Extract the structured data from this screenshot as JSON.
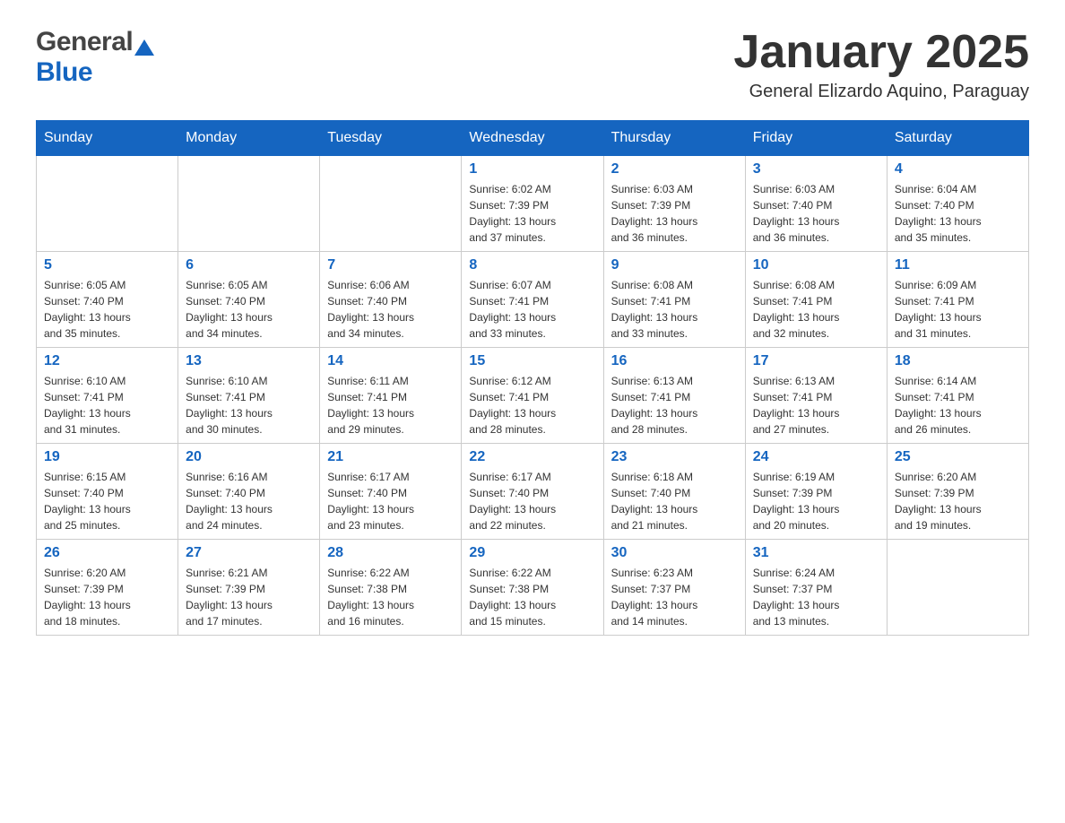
{
  "header": {
    "logo_general": "General",
    "logo_blue": "Blue",
    "main_title": "January 2025",
    "subtitle": "General Elizardo Aquino, Paraguay"
  },
  "calendar": {
    "days_of_week": [
      "Sunday",
      "Monday",
      "Tuesday",
      "Wednesday",
      "Thursday",
      "Friday",
      "Saturday"
    ],
    "weeks": [
      [
        {
          "day": "",
          "info": ""
        },
        {
          "day": "",
          "info": ""
        },
        {
          "day": "",
          "info": ""
        },
        {
          "day": "1",
          "info": "Sunrise: 6:02 AM\nSunset: 7:39 PM\nDaylight: 13 hours\nand 37 minutes."
        },
        {
          "day": "2",
          "info": "Sunrise: 6:03 AM\nSunset: 7:39 PM\nDaylight: 13 hours\nand 36 minutes."
        },
        {
          "day": "3",
          "info": "Sunrise: 6:03 AM\nSunset: 7:40 PM\nDaylight: 13 hours\nand 36 minutes."
        },
        {
          "day": "4",
          "info": "Sunrise: 6:04 AM\nSunset: 7:40 PM\nDaylight: 13 hours\nand 35 minutes."
        }
      ],
      [
        {
          "day": "5",
          "info": "Sunrise: 6:05 AM\nSunset: 7:40 PM\nDaylight: 13 hours\nand 35 minutes."
        },
        {
          "day": "6",
          "info": "Sunrise: 6:05 AM\nSunset: 7:40 PM\nDaylight: 13 hours\nand 34 minutes."
        },
        {
          "day": "7",
          "info": "Sunrise: 6:06 AM\nSunset: 7:40 PM\nDaylight: 13 hours\nand 34 minutes."
        },
        {
          "day": "8",
          "info": "Sunrise: 6:07 AM\nSunset: 7:41 PM\nDaylight: 13 hours\nand 33 minutes."
        },
        {
          "day": "9",
          "info": "Sunrise: 6:08 AM\nSunset: 7:41 PM\nDaylight: 13 hours\nand 33 minutes."
        },
        {
          "day": "10",
          "info": "Sunrise: 6:08 AM\nSunset: 7:41 PM\nDaylight: 13 hours\nand 32 minutes."
        },
        {
          "day": "11",
          "info": "Sunrise: 6:09 AM\nSunset: 7:41 PM\nDaylight: 13 hours\nand 31 minutes."
        }
      ],
      [
        {
          "day": "12",
          "info": "Sunrise: 6:10 AM\nSunset: 7:41 PM\nDaylight: 13 hours\nand 31 minutes."
        },
        {
          "day": "13",
          "info": "Sunrise: 6:10 AM\nSunset: 7:41 PM\nDaylight: 13 hours\nand 30 minutes."
        },
        {
          "day": "14",
          "info": "Sunrise: 6:11 AM\nSunset: 7:41 PM\nDaylight: 13 hours\nand 29 minutes."
        },
        {
          "day": "15",
          "info": "Sunrise: 6:12 AM\nSunset: 7:41 PM\nDaylight: 13 hours\nand 28 minutes."
        },
        {
          "day": "16",
          "info": "Sunrise: 6:13 AM\nSunset: 7:41 PM\nDaylight: 13 hours\nand 28 minutes."
        },
        {
          "day": "17",
          "info": "Sunrise: 6:13 AM\nSunset: 7:41 PM\nDaylight: 13 hours\nand 27 minutes."
        },
        {
          "day": "18",
          "info": "Sunrise: 6:14 AM\nSunset: 7:41 PM\nDaylight: 13 hours\nand 26 minutes."
        }
      ],
      [
        {
          "day": "19",
          "info": "Sunrise: 6:15 AM\nSunset: 7:40 PM\nDaylight: 13 hours\nand 25 minutes."
        },
        {
          "day": "20",
          "info": "Sunrise: 6:16 AM\nSunset: 7:40 PM\nDaylight: 13 hours\nand 24 minutes."
        },
        {
          "day": "21",
          "info": "Sunrise: 6:17 AM\nSunset: 7:40 PM\nDaylight: 13 hours\nand 23 minutes."
        },
        {
          "day": "22",
          "info": "Sunrise: 6:17 AM\nSunset: 7:40 PM\nDaylight: 13 hours\nand 22 minutes."
        },
        {
          "day": "23",
          "info": "Sunrise: 6:18 AM\nSunset: 7:40 PM\nDaylight: 13 hours\nand 21 minutes."
        },
        {
          "day": "24",
          "info": "Sunrise: 6:19 AM\nSunset: 7:39 PM\nDaylight: 13 hours\nand 20 minutes."
        },
        {
          "day": "25",
          "info": "Sunrise: 6:20 AM\nSunset: 7:39 PM\nDaylight: 13 hours\nand 19 minutes."
        }
      ],
      [
        {
          "day": "26",
          "info": "Sunrise: 6:20 AM\nSunset: 7:39 PM\nDaylight: 13 hours\nand 18 minutes."
        },
        {
          "day": "27",
          "info": "Sunrise: 6:21 AM\nSunset: 7:39 PM\nDaylight: 13 hours\nand 17 minutes."
        },
        {
          "day": "28",
          "info": "Sunrise: 6:22 AM\nSunset: 7:38 PM\nDaylight: 13 hours\nand 16 minutes."
        },
        {
          "day": "29",
          "info": "Sunrise: 6:22 AM\nSunset: 7:38 PM\nDaylight: 13 hours\nand 15 minutes."
        },
        {
          "day": "30",
          "info": "Sunrise: 6:23 AM\nSunset: 7:37 PM\nDaylight: 13 hours\nand 14 minutes."
        },
        {
          "day": "31",
          "info": "Sunrise: 6:24 AM\nSunset: 7:37 PM\nDaylight: 13 hours\nand 13 minutes."
        },
        {
          "day": "",
          "info": ""
        }
      ]
    ]
  }
}
